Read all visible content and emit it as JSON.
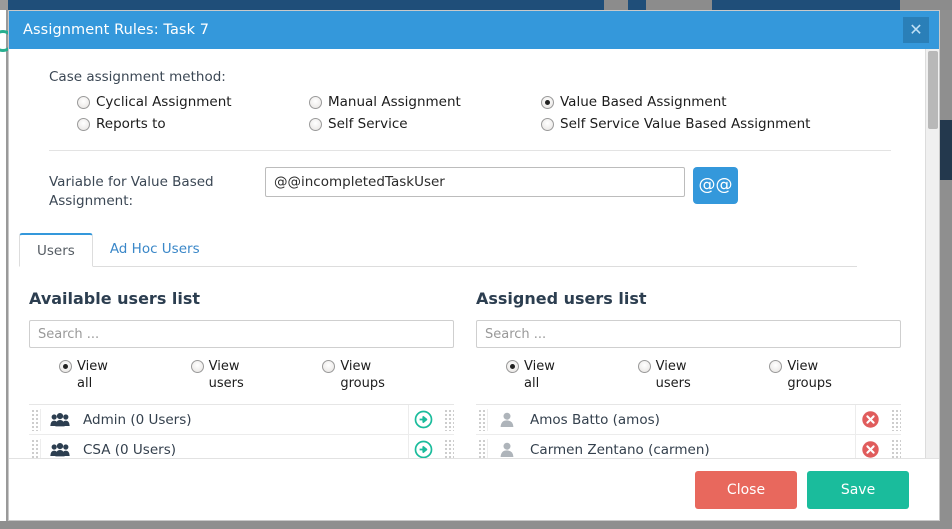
{
  "window": {
    "title": "Assignment Rules: Task 7",
    "close_icon": "close-icon",
    "close_label": "✕"
  },
  "colors": {
    "header_blue": "#3498db",
    "accent_blue": "#3498db",
    "close_red": "#e8685d",
    "save_green": "#1abc9c",
    "add_green": "#1abc9c",
    "remove_red": "#e05c5c"
  },
  "assignment": {
    "label": "Case assignment method:",
    "options": [
      {
        "label": "Cyclical Assignment",
        "checked": false
      },
      {
        "label": "Manual Assignment",
        "checked": false
      },
      {
        "label": "Value Based Assignment",
        "checked": true
      },
      {
        "label": "Reports to",
        "checked": false
      },
      {
        "label": "Self Service",
        "checked": false
      },
      {
        "label": "Self Service Value Based Assignment",
        "checked": false
      }
    ]
  },
  "variable": {
    "label": "Variable for Value Based Assignment:",
    "value": "@@incompletedTaskUser",
    "placeholder": "",
    "button_label": "@@",
    "button_icon": "at-at-icon"
  },
  "tabs": [
    {
      "label": "Users",
      "active": true
    },
    {
      "label": "Ad Hoc Users",
      "active": false
    }
  ],
  "available": {
    "title": "Available users list",
    "search_placeholder": "Search ...",
    "search_value": "",
    "view_options": [
      {
        "line1": "View",
        "line2": "all",
        "checked": true
      },
      {
        "line1": "View",
        "line2": "users",
        "checked": false
      },
      {
        "line1": "View",
        "line2": "groups",
        "checked": false
      }
    ],
    "rows": [
      {
        "name": "Admin (0 Users)",
        "icon": "group-icon",
        "action_icon": "add-arrow-icon"
      },
      {
        "name": "CSA (0 Users)",
        "icon": "group-icon",
        "action_icon": "add-arrow-icon"
      }
    ]
  },
  "assigned": {
    "title": "Assigned users list",
    "search_placeholder": "Search ...",
    "search_value": "",
    "view_options": [
      {
        "line1": "View",
        "line2": "all",
        "checked": true
      },
      {
        "line1": "View",
        "line2": "users",
        "checked": false
      },
      {
        "line1": "View",
        "line2": "groups",
        "checked": false
      }
    ],
    "rows": [
      {
        "name": "Amos Batto (amos)",
        "icon": "user-icon",
        "action_icon": "remove-x-icon"
      },
      {
        "name": "Carmen Zentano (carmen)",
        "icon": "user-icon",
        "action_icon": "remove-x-icon"
      }
    ]
  },
  "footer": {
    "close_label": "Close",
    "save_label": "Save"
  }
}
